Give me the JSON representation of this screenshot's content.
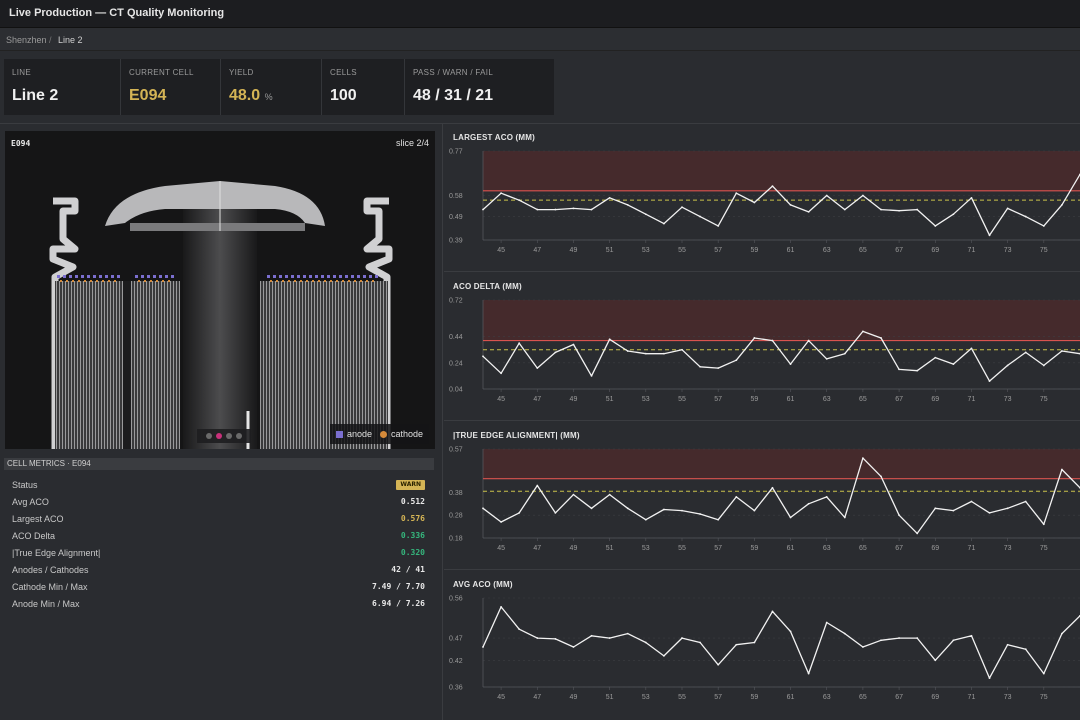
{
  "window": {
    "title": "Live Production — CT Quality Monitoring"
  },
  "breadcrumb": {
    "site": "Shenzhen",
    "separator": "/",
    "line": "Line 2"
  },
  "kpis": [
    {
      "label": "LINE",
      "value": "Line 2"
    },
    {
      "label": "CURRENT CELL",
      "value": "E094"
    },
    {
      "label": "YIELD",
      "value": "48.0",
      "unit": "%"
    },
    {
      "label": "CELLS",
      "value": "100"
    },
    {
      "label": "PASS / WARN / FAIL",
      "value": "48 / 31 / 21"
    }
  ],
  "ct_view": {
    "cell_id": "E094",
    "slice": "slice 2/4",
    "slice_index": 2,
    "slice_count": 4,
    "legend": [
      {
        "label": "anode",
        "color": "#7b6fd0"
      },
      {
        "label": "cathode",
        "color": "#d58a3a"
      }
    ]
  },
  "cell_metrics": {
    "header": "CELL METRICS · E094",
    "rows": [
      {
        "label": "Status",
        "badge": "WARN"
      },
      {
        "label": "Avg ACO",
        "value": "0.512",
        "tone": "default"
      },
      {
        "label": "Largest ACO",
        "value": "0.576",
        "tone": "gold"
      },
      {
        "label": "ACO Delta",
        "value": "0.336",
        "tone": "green"
      },
      {
        "label": "|True Edge Alignment|",
        "value": "0.320",
        "tone": "green"
      },
      {
        "label": "Anodes / Cathodes",
        "value": "42 / 41",
        "tone": "default"
      },
      {
        "label": "Cathode Min / Max",
        "value": "7.49 / 7.70",
        "tone": "default"
      },
      {
        "label": "Anode Min / Max",
        "value": "6.94 / 7.26",
        "tone": "default"
      }
    ]
  },
  "colors": {
    "limit_red": "#d9534f",
    "warn_yellow": "#c9c24a",
    "fail_zone": "#4a2a2c",
    "line": "#f2f2f2"
  },
  "chart_data": [
    {
      "type": "line",
      "title": "LARGEST ACO (MM)",
      "x": [
        44,
        45,
        46,
        47,
        48,
        49,
        50,
        51,
        52,
        53,
        54,
        55,
        56,
        57,
        58,
        59,
        60,
        61,
        62,
        63,
        64,
        65,
        66,
        67,
        68,
        69,
        70,
        71,
        72,
        73,
        74,
        75,
        76,
        77
      ],
      "values": [
        0.52,
        0.59,
        0.56,
        0.52,
        0.52,
        0.525,
        0.52,
        0.57,
        0.54,
        0.5,
        0.46,
        0.53,
        0.49,
        0.45,
        0.59,
        0.55,
        0.62,
        0.54,
        0.51,
        0.58,
        0.52,
        0.58,
        0.52,
        0.515,
        0.52,
        0.45,
        0.5,
        0.57,
        0.41,
        0.525,
        0.49,
        0.45,
        0.54,
        0.67
      ],
      "xticks": [
        "45",
        "47",
        "49",
        "51",
        "53",
        "55",
        "57",
        "59",
        "61",
        "63",
        "65",
        "67",
        "69",
        "71",
        "73",
        "75"
      ],
      "yticks": [
        "0.77",
        "0.58",
        "0.49",
        "0.39"
      ],
      "ylim": [
        0.39,
        0.77
      ],
      "fail_threshold": 0.6,
      "warn_threshold": 0.56
    },
    {
      "type": "line",
      "title": "ACO DELTA (MM)",
      "x": [
        44,
        45,
        46,
        47,
        48,
        49,
        50,
        51,
        52,
        53,
        54,
        55,
        56,
        57,
        58,
        59,
        60,
        61,
        62,
        63,
        64,
        65,
        66,
        67,
        68,
        69,
        70,
        71,
        72,
        73,
        74,
        75,
        76,
        77
      ],
      "values": [
        0.29,
        0.16,
        0.39,
        0.2,
        0.32,
        0.38,
        0.14,
        0.42,
        0.33,
        0.31,
        0.31,
        0.34,
        0.21,
        0.2,
        0.26,
        0.43,
        0.41,
        0.23,
        0.41,
        0.27,
        0.31,
        0.48,
        0.43,
        0.19,
        0.18,
        0.28,
        0.23,
        0.35,
        0.1,
        0.22,
        0.32,
        0.22,
        0.33,
        0.31
      ],
      "xticks": [
        "45",
        "47",
        "49",
        "51",
        "53",
        "55",
        "57",
        "59",
        "61",
        "63",
        "65",
        "67",
        "69",
        "71",
        "73",
        "75"
      ],
      "yticks": [
        "0.72",
        "0.44",
        "0.24",
        "0.04"
      ],
      "ylim": [
        0.04,
        0.72
      ],
      "fail_threshold": 0.41,
      "warn_threshold": 0.34
    },
    {
      "type": "line",
      "title": "|TRUE EDGE ALIGNMENT| (MM)",
      "x": [
        44,
        45,
        46,
        47,
        48,
        49,
        50,
        51,
        52,
        53,
        54,
        55,
        56,
        57,
        58,
        59,
        60,
        61,
        62,
        63,
        64,
        65,
        66,
        67,
        68,
        69,
        70,
        71,
        72,
        73,
        74,
        75,
        76,
        77
      ],
      "values": [
        0.31,
        0.25,
        0.29,
        0.41,
        0.29,
        0.37,
        0.31,
        0.37,
        0.31,
        0.26,
        0.305,
        0.3,
        0.285,
        0.26,
        0.36,
        0.3,
        0.4,
        0.27,
        0.33,
        0.36,
        0.27,
        0.53,
        0.45,
        0.28,
        0.2,
        0.31,
        0.3,
        0.34,
        0.29,
        0.31,
        0.34,
        0.24,
        0.48,
        0.4
      ],
      "xticks": [
        "45",
        "47",
        "49",
        "51",
        "53",
        "55",
        "57",
        "59",
        "61",
        "63",
        "65",
        "67",
        "69",
        "71",
        "73",
        "75"
      ],
      "yticks": [
        "0.57",
        "0.38",
        "0.28",
        "0.18"
      ],
      "ylim": [
        0.18,
        0.57
      ],
      "fail_threshold": 0.44,
      "warn_threshold": 0.385
    },
    {
      "type": "line",
      "title": "AVG ACO (MM)",
      "x": [
        44,
        45,
        46,
        47,
        48,
        49,
        50,
        51,
        52,
        53,
        54,
        55,
        56,
        57,
        58,
        59,
        60,
        61,
        62,
        63,
        64,
        65,
        66,
        67,
        68,
        69,
        70,
        71,
        72,
        73,
        74,
        75,
        76,
        77
      ],
      "values": [
        0.45,
        0.54,
        0.49,
        0.47,
        0.468,
        0.45,
        0.475,
        0.47,
        0.48,
        0.46,
        0.43,
        0.47,
        0.46,
        0.41,
        0.455,
        0.46,
        0.53,
        0.485,
        0.39,
        0.505,
        0.48,
        0.45,
        0.465,
        0.47,
        0.47,
        0.42,
        0.465,
        0.475,
        0.38,
        0.455,
        0.445,
        0.39,
        0.48,
        0.52
      ],
      "xticks": [
        "45",
        "47",
        "49",
        "51",
        "53",
        "55",
        "57",
        "59",
        "61",
        "63",
        "65",
        "67",
        "69",
        "71",
        "73",
        "75"
      ],
      "yticks": [
        "0.56",
        "0.47",
        "0.42",
        "0.36"
      ],
      "ylim": [
        0.36,
        0.56
      ]
    }
  ]
}
